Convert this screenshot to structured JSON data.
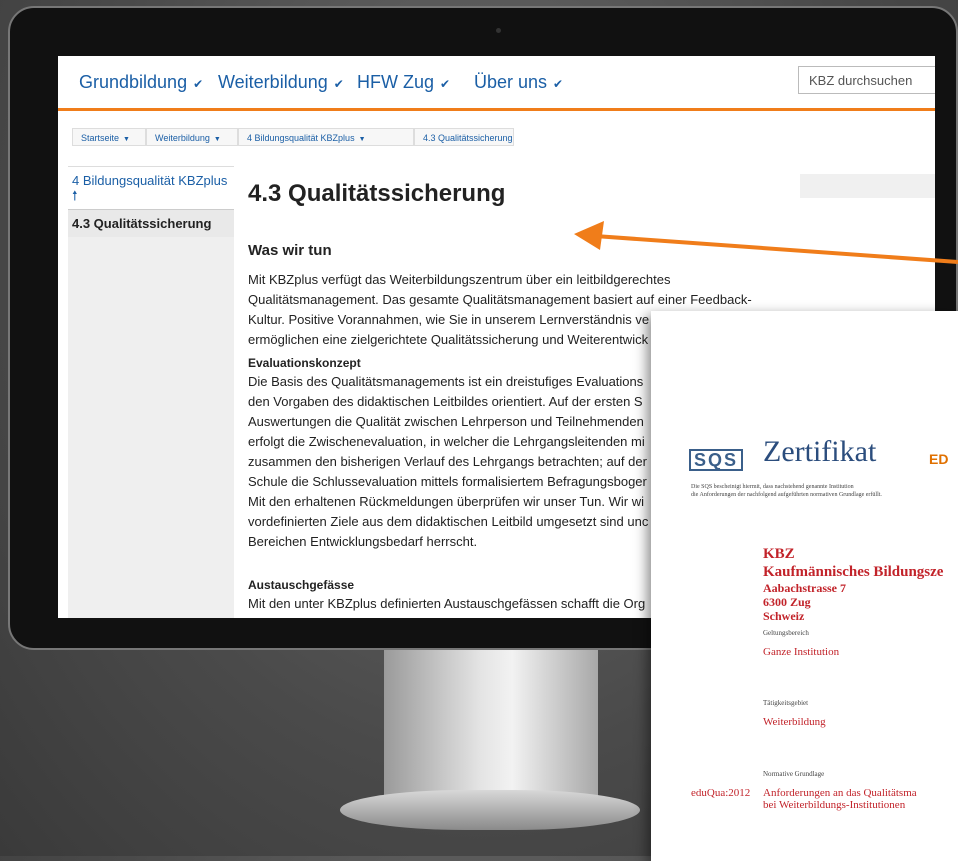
{
  "nav": {
    "items": [
      "Grundbildung",
      "Weiterbildung",
      "HFW Zug",
      "Über uns"
    ],
    "search_placeholder": "KBZ durchsuchen"
  },
  "breadcrumb": [
    "Startseite",
    "Weiterbildung",
    "4 Bildungsqualität KBZplus",
    "4.3 Qualitätssicherung"
  ],
  "sidebar": {
    "parent_label": "4 Bildungsqualität KBZplus",
    "current_label": "4.3 Qualitätssicherung"
  },
  "content": {
    "title": "4.3 Qualitätssicherung",
    "section_title": "Was wir tun",
    "intro_lines": [
      "Mit KBZplus verfügt das Weiterbildungszentrum über ein leitbildgerechtes",
      "Qualitätsmanagement. Das gesamte Qualitätsmanagement basiert auf einer Feedback-",
      "Kultur. Positive Vorannahmen, wie Sie in unserem Lernverständnis ve",
      "ermöglichen eine zielgerichtete Qualitätssicherung und Weiterentwick"
    ],
    "eval_title": "Evaluationskonzept",
    "eval_lines": [
      "Die Basis des Qualitätsmanagements ist ein dreistufiges Evaluations",
      "den Vorgaben des didaktischen Leitbildes orientiert. Auf der ersten S",
      "Auswertungen die Qualität zwischen Lehrperson und Teilnehmenden",
      "erfolgt die Zwischenevaluation, in welcher die Lehrgangsleitenden mi",
      "zusammen den bisherigen Verlauf des Lehrgangs betrachten; auf der",
      "Schule die Schlussevaluation mittels formalisiertem Befragungsboger",
      "Mit den erhaltenen Rückmeldungen überprüfen wir unser Tun. Wir wi",
      "vordefinierten Ziele aus dem didaktischen Leitbild umgesetzt sind unc",
      "Bereichen Entwicklungsbedarf herrscht."
    ],
    "exchange_title": "Austauschgefässe",
    "exchange_line": "Mit den unter KBZplus definierten Austauschgefässen schafft die Org"
  },
  "certificate": {
    "logo": "SQS",
    "title": "Zertifikat",
    "brand_fragment": "ED",
    "statement_lines": [
      "Die SQS bescheinigt hiermit, dass nachstehend genannte Institution",
      "die Anforderungen der nachfolgend aufgeführten normativen Grundlage erfüllt."
    ],
    "org_short": "KBZ",
    "org_name": "Kaufmännisches Bildungsze",
    "address": [
      "Aabachstrasse 7",
      "6300 Zug",
      "Schweiz"
    ],
    "scope_label": "Geltungsbereich",
    "scope_value": "Ganze Institution",
    "activity_label": "Tätigkeitsgebiet",
    "activity_value": "Weiterbildung",
    "norm_label": "Normative Grundlage",
    "norm_code": "eduQua:2012",
    "norm_lines": [
      "Anforderungen an das Qualitätsma",
      "bei Weiterbildungs-Institutionen"
    ]
  },
  "colors": {
    "accent_orange": "#f07d1a",
    "link_blue": "#1b5fa6",
    "cert_red": "#c2232a",
    "cert_blue": "#2b4d7d"
  }
}
